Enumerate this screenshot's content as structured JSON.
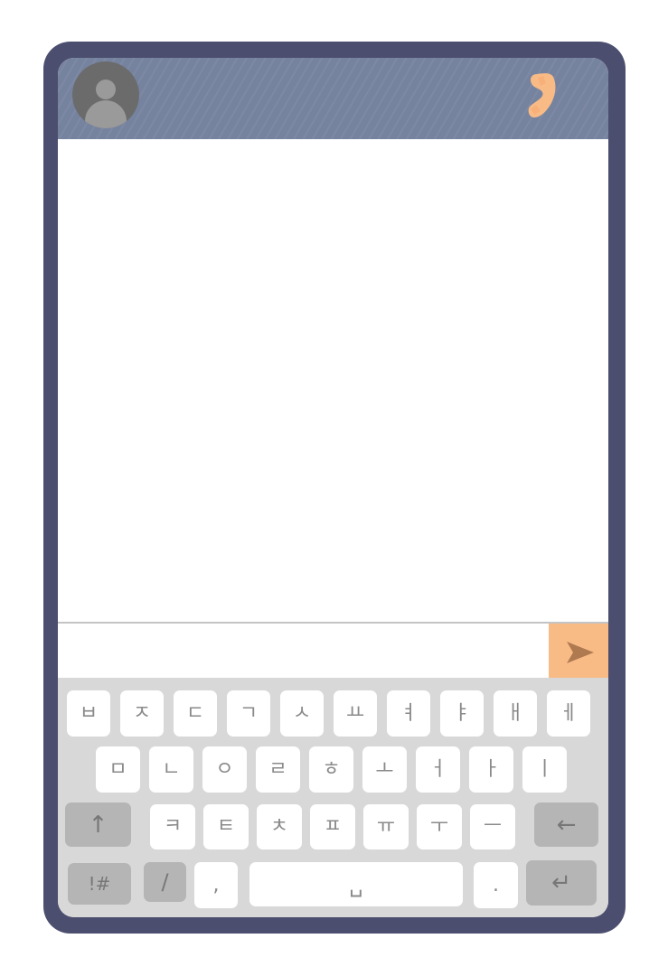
{
  "header": {
    "avatar_icon": "person-icon",
    "call_icon": "phone-icon",
    "colors": {
      "bar": "#76839f",
      "call": "#f9bb86"
    }
  },
  "composer": {
    "input_value": "",
    "send_icon": "send-arrow-icon",
    "send_color": "#f9bb86"
  },
  "keyboard": {
    "row1": [
      "ㅂ",
      "ㅈ",
      "ㄷ",
      "ㄱ",
      "ㅅ",
      "ㅛ",
      "ㅕ",
      "ㅑ",
      "ㅐ",
      "ㅔ"
    ],
    "row2": [
      "ㅁ",
      "ㄴ",
      "ㅇ",
      "ㄹ",
      "ㅎ",
      "ㅗ",
      "ㅓ",
      "ㅏ",
      "ㅣ"
    ],
    "row3": [
      "ㅋ",
      "ㅌ",
      "ㅊ",
      "ㅍ",
      "ㅠ",
      "ㅜ",
      "ㅡ"
    ],
    "shift_label": "↑",
    "backspace_label": "←",
    "symbols_label": "!#",
    "slash_label": "/",
    "comma_label": ",",
    "space_label": "␣",
    "period_label": ".",
    "enter_label": "↵"
  }
}
